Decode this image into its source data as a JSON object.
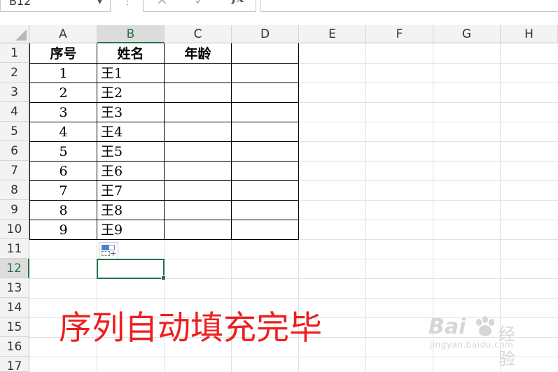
{
  "formula_bar": {
    "name_box": "B12",
    "cancel_glyph": "✕",
    "enter_glyph": "✓",
    "fx_label": "fx",
    "more_glyph": "⋮",
    "formula_value": ""
  },
  "columns": [
    "A",
    "B",
    "C",
    "D",
    "E",
    "F",
    "G",
    "H"
  ],
  "selected_column": "B",
  "rows": [
    "1",
    "2",
    "3",
    "4",
    "5",
    "6",
    "7",
    "8",
    "9",
    "10",
    "11",
    "12",
    "13",
    "14",
    "15",
    "16",
    "17"
  ],
  "selected_row": "12",
  "table": {
    "headers": [
      "序号",
      "姓名",
      "年龄",
      ""
    ],
    "data": [
      [
        "1",
        "王1"
      ],
      [
        "2",
        "王2"
      ],
      [
        "3",
        "王3"
      ],
      [
        "4",
        "王4"
      ],
      [
        "5",
        "王5"
      ],
      [
        "6",
        "王6"
      ],
      [
        "7",
        "王7"
      ],
      [
        "8",
        "王8"
      ],
      [
        "9",
        "王9"
      ]
    ]
  },
  "caption": "序列自动填充完毕",
  "watermark": {
    "logo": "Bai",
    "logo_suffix": "经验",
    "url": "jingyan.baidu.com"
  },
  "colors": {
    "accent": "#217346",
    "caption": "#ee1f1f"
  },
  "icons": {
    "autofill_options": "auto-fill-options-icon",
    "corner": "select-all-triangle-icon"
  }
}
